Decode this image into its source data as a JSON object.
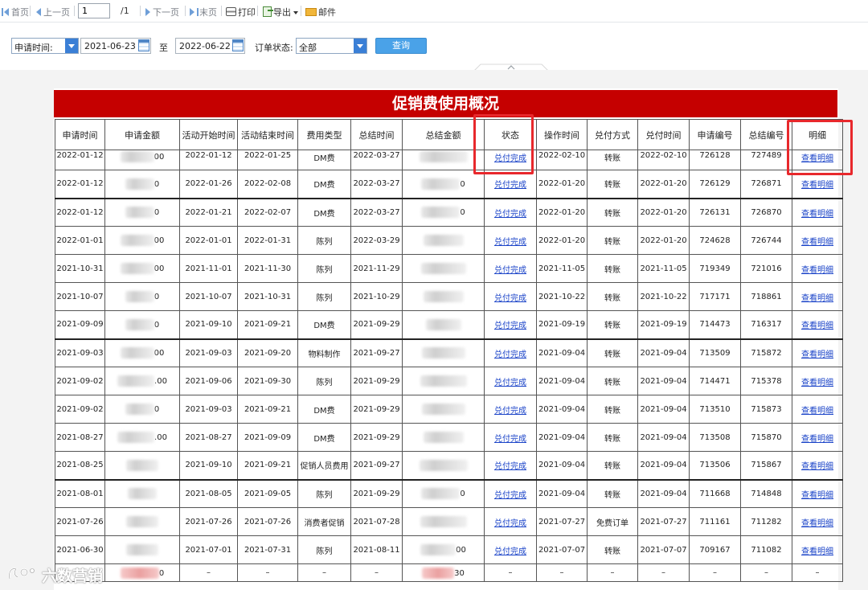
{
  "toolbar": {
    "first_label": "首页",
    "prev_label": "上一页",
    "page_value": "1",
    "page_total": "/1",
    "next_label": "下一页",
    "last_label": "末页",
    "print_label": "打印",
    "export_label": "导出",
    "mail_label": "邮件"
  },
  "filter": {
    "date_type": "申请时间:",
    "date_from": "2021-06-23",
    "to_label": "至",
    "date_to": "2022-06-22",
    "status_label": "订单状态:",
    "status_value": "全部",
    "query_label": "查询"
  },
  "report": {
    "title": "促销费使用概况",
    "headers": [
      "申请时间",
      "申请金额",
      "活动开始时间",
      "活动结束时间",
      "费用类型",
      "总结时间",
      "总结金额",
      "状态",
      "操作时间",
      "兑付方式",
      "兑付时间",
      "申请编号",
      "总结编号",
      "明细"
    ],
    "rows": [
      {
        "apply_date": "2022-01-12",
        "apply_amount_tail": "00",
        "start": "2022-01-12",
        "end": "2022-01-25",
        "type": "DM费",
        "summary_date": "2022-03-27",
        "summary_amount_tail": "",
        "status": "兑付完成",
        "op_date": "2022-02-10",
        "pay_method": "转账",
        "pay_date": "2022-02-10",
        "apply_no": "726128",
        "summary_no": "727489",
        "detail": "查看明细"
      },
      {
        "apply_date": "2022-01-12",
        "apply_amount_tail": "0",
        "start": "2022-01-26",
        "end": "2022-02-08",
        "type": "DM费",
        "summary_date": "2022-03-27",
        "summary_amount_tail": "0",
        "status": "兑付完成",
        "op_date": "2022-01-20",
        "pay_method": "转账",
        "pay_date": "2022-01-20",
        "apply_no": "726129",
        "summary_no": "726871",
        "detail": "查看明细"
      },
      {
        "apply_date": "2022-01-12",
        "apply_amount_tail": "0",
        "start": "2022-01-21",
        "end": "2022-02-07",
        "type": "DM费",
        "summary_date": "2022-03-27",
        "summary_amount_tail": "0",
        "status": "兑付完成",
        "op_date": "2022-01-20",
        "pay_method": "转账",
        "pay_date": "2022-01-20",
        "apply_no": "726131",
        "summary_no": "726870",
        "detail": "查看明细"
      },
      {
        "apply_date": "2022-01-01",
        "apply_amount_tail": "00",
        "start": "2022-01-01",
        "end": "2022-01-31",
        "type": "陈列",
        "summary_date": "2022-03-29",
        "summary_amount_tail": "",
        "status": "兑付完成",
        "op_date": "2022-01-20",
        "pay_method": "转账",
        "pay_date": "2022-01-20",
        "apply_no": "724628",
        "summary_no": "726744",
        "detail": "查看明细"
      },
      {
        "apply_date": "2021-10-31",
        "apply_amount_tail": "00",
        "start": "2021-11-01",
        "end": "2021-11-30",
        "type": "陈列",
        "summary_date": "2021-11-29",
        "summary_amount_tail": "",
        "status": "兑付完成",
        "op_date": "2021-11-05",
        "pay_method": "转账",
        "pay_date": "2021-11-05",
        "apply_no": "719349",
        "summary_no": "721016",
        "detail": "查看明细"
      },
      {
        "apply_date": "2021-10-07",
        "apply_amount_tail": "0",
        "start": "2021-10-07",
        "end": "2021-10-31",
        "type": "陈列",
        "summary_date": "2021-10-29",
        "summary_amount_tail": "",
        "status": "兑付完成",
        "op_date": "2021-10-22",
        "pay_method": "转账",
        "pay_date": "2021-10-22",
        "apply_no": "717171",
        "summary_no": "718861",
        "detail": "查看明细"
      },
      {
        "apply_date": "2021-09-09",
        "apply_amount_tail": "0",
        "start": "2021-09-10",
        "end": "2021-09-21",
        "type": "DM费",
        "summary_date": "2021-09-29",
        "summary_amount_tail": "",
        "status": "兑付完成",
        "op_date": "2021-09-19",
        "pay_method": "转账",
        "pay_date": "2021-09-19",
        "apply_no": "714473",
        "summary_no": "716317",
        "detail": "查看明细"
      },
      {
        "apply_date": "2021-09-03",
        "apply_amount_tail": "00",
        "start": "2021-09-03",
        "end": "2021-09-20",
        "type": "物料制作",
        "summary_date": "2021-09-27",
        "summary_amount_tail": "",
        "status": "兑付完成",
        "op_date": "2021-09-04",
        "pay_method": "转账",
        "pay_date": "2021-09-04",
        "apply_no": "713509",
        "summary_no": "715872",
        "detail": "查看明细"
      },
      {
        "apply_date": "2021-09-02",
        "apply_amount_tail": ".00",
        "start": "2021-09-06",
        "end": "2021-09-30",
        "type": "陈列",
        "summary_date": "2021-09-29",
        "summary_amount_tail": "",
        "status": "兑付完成",
        "op_date": "2021-09-04",
        "pay_method": "转账",
        "pay_date": "2021-09-04",
        "apply_no": "714471",
        "summary_no": "715378",
        "detail": "查看明细"
      },
      {
        "apply_date": "2021-09-02",
        "apply_amount_tail": "0",
        "start": "2021-09-03",
        "end": "2021-09-21",
        "type": "DM费",
        "summary_date": "2021-09-29",
        "summary_amount_tail": "",
        "status": "兑付完成",
        "op_date": "2021-09-04",
        "pay_method": "转账",
        "pay_date": "2021-09-04",
        "apply_no": "713510",
        "summary_no": "715873",
        "detail": "查看明细"
      },
      {
        "apply_date": "2021-08-27",
        "apply_amount_tail": ".00",
        "start": "2021-08-27",
        "end": "2021-09-09",
        "type": "DM费",
        "summary_date": "2021-09-29",
        "summary_amount_tail": "",
        "status": "兑付完成",
        "op_date": "2021-09-04",
        "pay_method": "转账",
        "pay_date": "2021-09-04",
        "apply_no": "713508",
        "summary_no": "715870",
        "detail": "查看明细"
      },
      {
        "apply_date": "2021-08-25",
        "apply_amount_tail": "",
        "start": "2021-09-10",
        "end": "2021-09-21",
        "type": "促销人员费用",
        "summary_date": "2021-09-27",
        "summary_amount_tail": "",
        "status": "兑付完成",
        "op_date": "2021-09-04",
        "pay_method": "转账",
        "pay_date": "2021-09-04",
        "apply_no": "713506",
        "summary_no": "715867",
        "detail": "查看明细"
      },
      {
        "apply_date": "2021-08-01",
        "apply_amount_tail": "",
        "start": "2021-08-05",
        "end": "2021-09-05",
        "type": "陈列",
        "summary_date": "2021-09-29",
        "summary_amount_tail": "0",
        "status": "兑付完成",
        "op_date": "2021-09-04",
        "pay_method": "转账",
        "pay_date": "2021-09-04",
        "apply_no": "711668",
        "summary_no": "714848",
        "detail": "查看明细"
      },
      {
        "apply_date": "2021-07-26",
        "apply_amount_tail": "",
        "start": "2021-07-26",
        "end": "2021-07-26",
        "type": "消费者促销",
        "summary_date": "2021-07-28",
        "summary_amount_tail": "",
        "status": "兑付完成",
        "op_date": "2021-07-27",
        "pay_method": "免费订单",
        "pay_date": "2021-07-27",
        "apply_no": "711161",
        "summary_no": "711282",
        "detail": "查看明细"
      },
      {
        "apply_date": "2021-06-30",
        "apply_amount_tail": "",
        "start": "2021-07-01",
        "end": "2021-07-31",
        "type": "陈列",
        "summary_date": "2021-08-11",
        "summary_amount_tail": "00",
        "status": "兑付完成",
        "op_date": "2021-07-07",
        "pay_method": "转账",
        "pay_date": "2021-07-07",
        "apply_no": "709167",
        "summary_no": "711082",
        "detail": "查看明细"
      }
    ],
    "total_row": {
      "dash": "–",
      "apply_amount_tail": "0",
      "summary_amount_tail": "30"
    }
  },
  "watermark": "六数营销",
  "colors": {
    "title_bg": "#c50000",
    "link": "#1a43c8",
    "highlight": "#e8282c",
    "query_btn": "#4aa2e8"
  }
}
